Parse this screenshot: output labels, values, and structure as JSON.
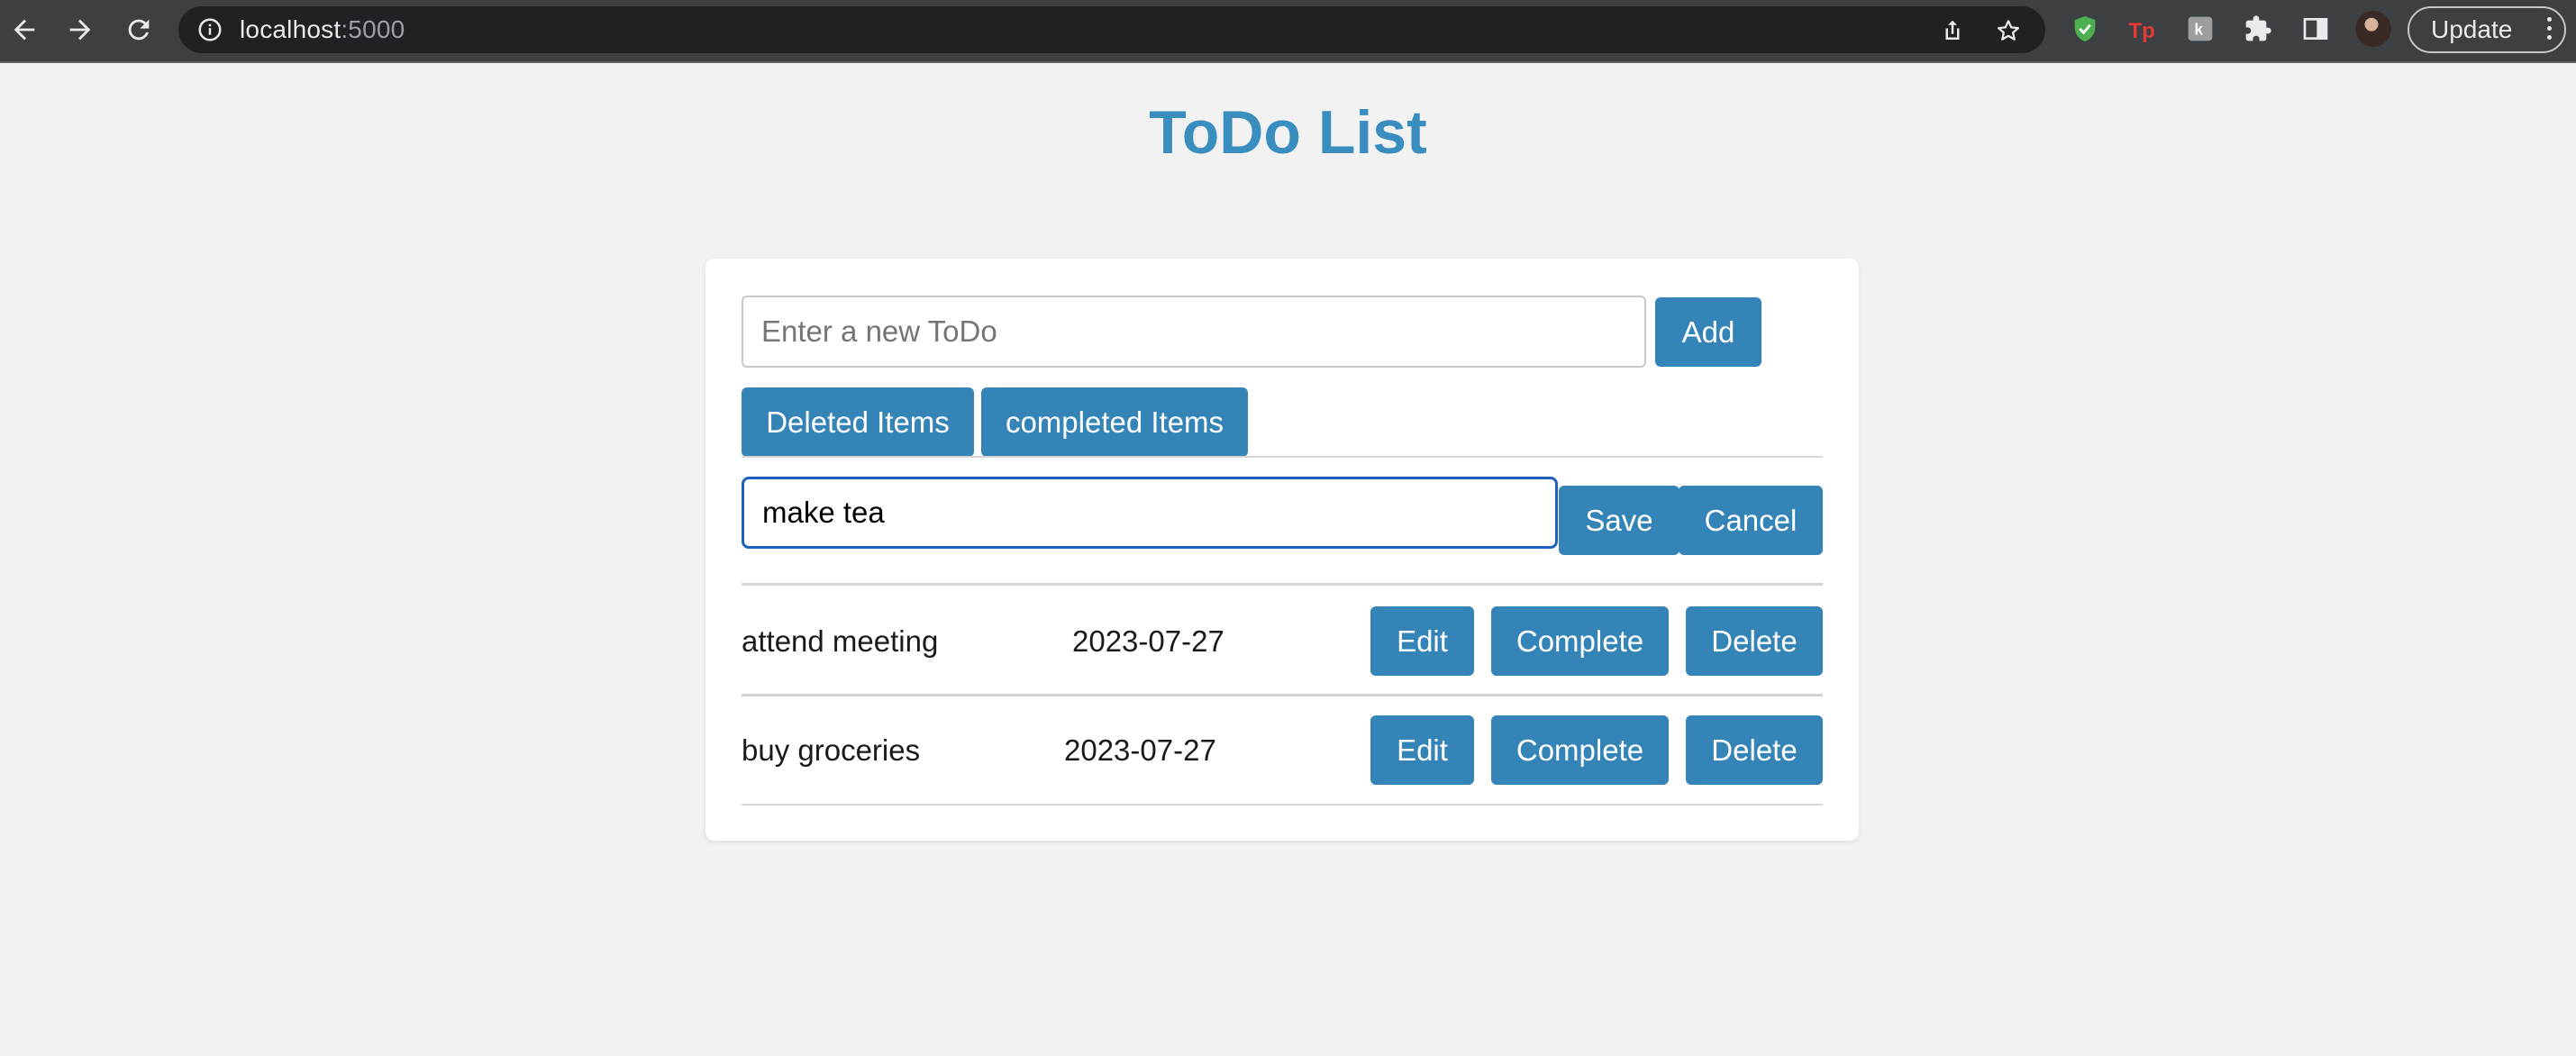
{
  "browser": {
    "url_host": "localhost",
    "url_port": ":5000",
    "update_label": "Update"
  },
  "page": {
    "title": "ToDo List"
  },
  "new_todo": {
    "placeholder": "Enter a new ToDo",
    "value": "",
    "add_label": "Add"
  },
  "filters": {
    "deleted_label": "Deleted Items",
    "completed_label": "completed Items"
  },
  "edit": {
    "value": "make tea",
    "save_label": "Save",
    "cancel_label": "Cancel"
  },
  "todos": [
    {
      "text": "attend meeting",
      "date": "2023-07-27",
      "edit_label": "Edit",
      "complete_label": "Complete",
      "delete_label": "Delete"
    },
    {
      "text": "buy groceries",
      "date": "2023-07-27",
      "edit_label": "Edit",
      "complete_label": "Complete",
      "delete_label": "Delete"
    }
  ],
  "colors": {
    "accent": "#3584b7",
    "title": "#3a8dbf",
    "page_background": "#f2f2f2",
    "focus_border": "#1f5fbf",
    "chrome_background": "#3c4043"
  },
  "icons": {
    "back": "arrow-left-icon",
    "forward": "arrow-right-icon",
    "reload": "reload-icon",
    "site_info": "info-icon",
    "share": "share-icon",
    "bookmark": "star-icon",
    "extension_1": "shield-check-icon",
    "extension_2": "tp-logo-icon",
    "extension_3": "k-extension-icon",
    "extensions": "puzzle-icon",
    "side_panel": "side-panel-icon",
    "menu": "kebab-menu-icon"
  }
}
